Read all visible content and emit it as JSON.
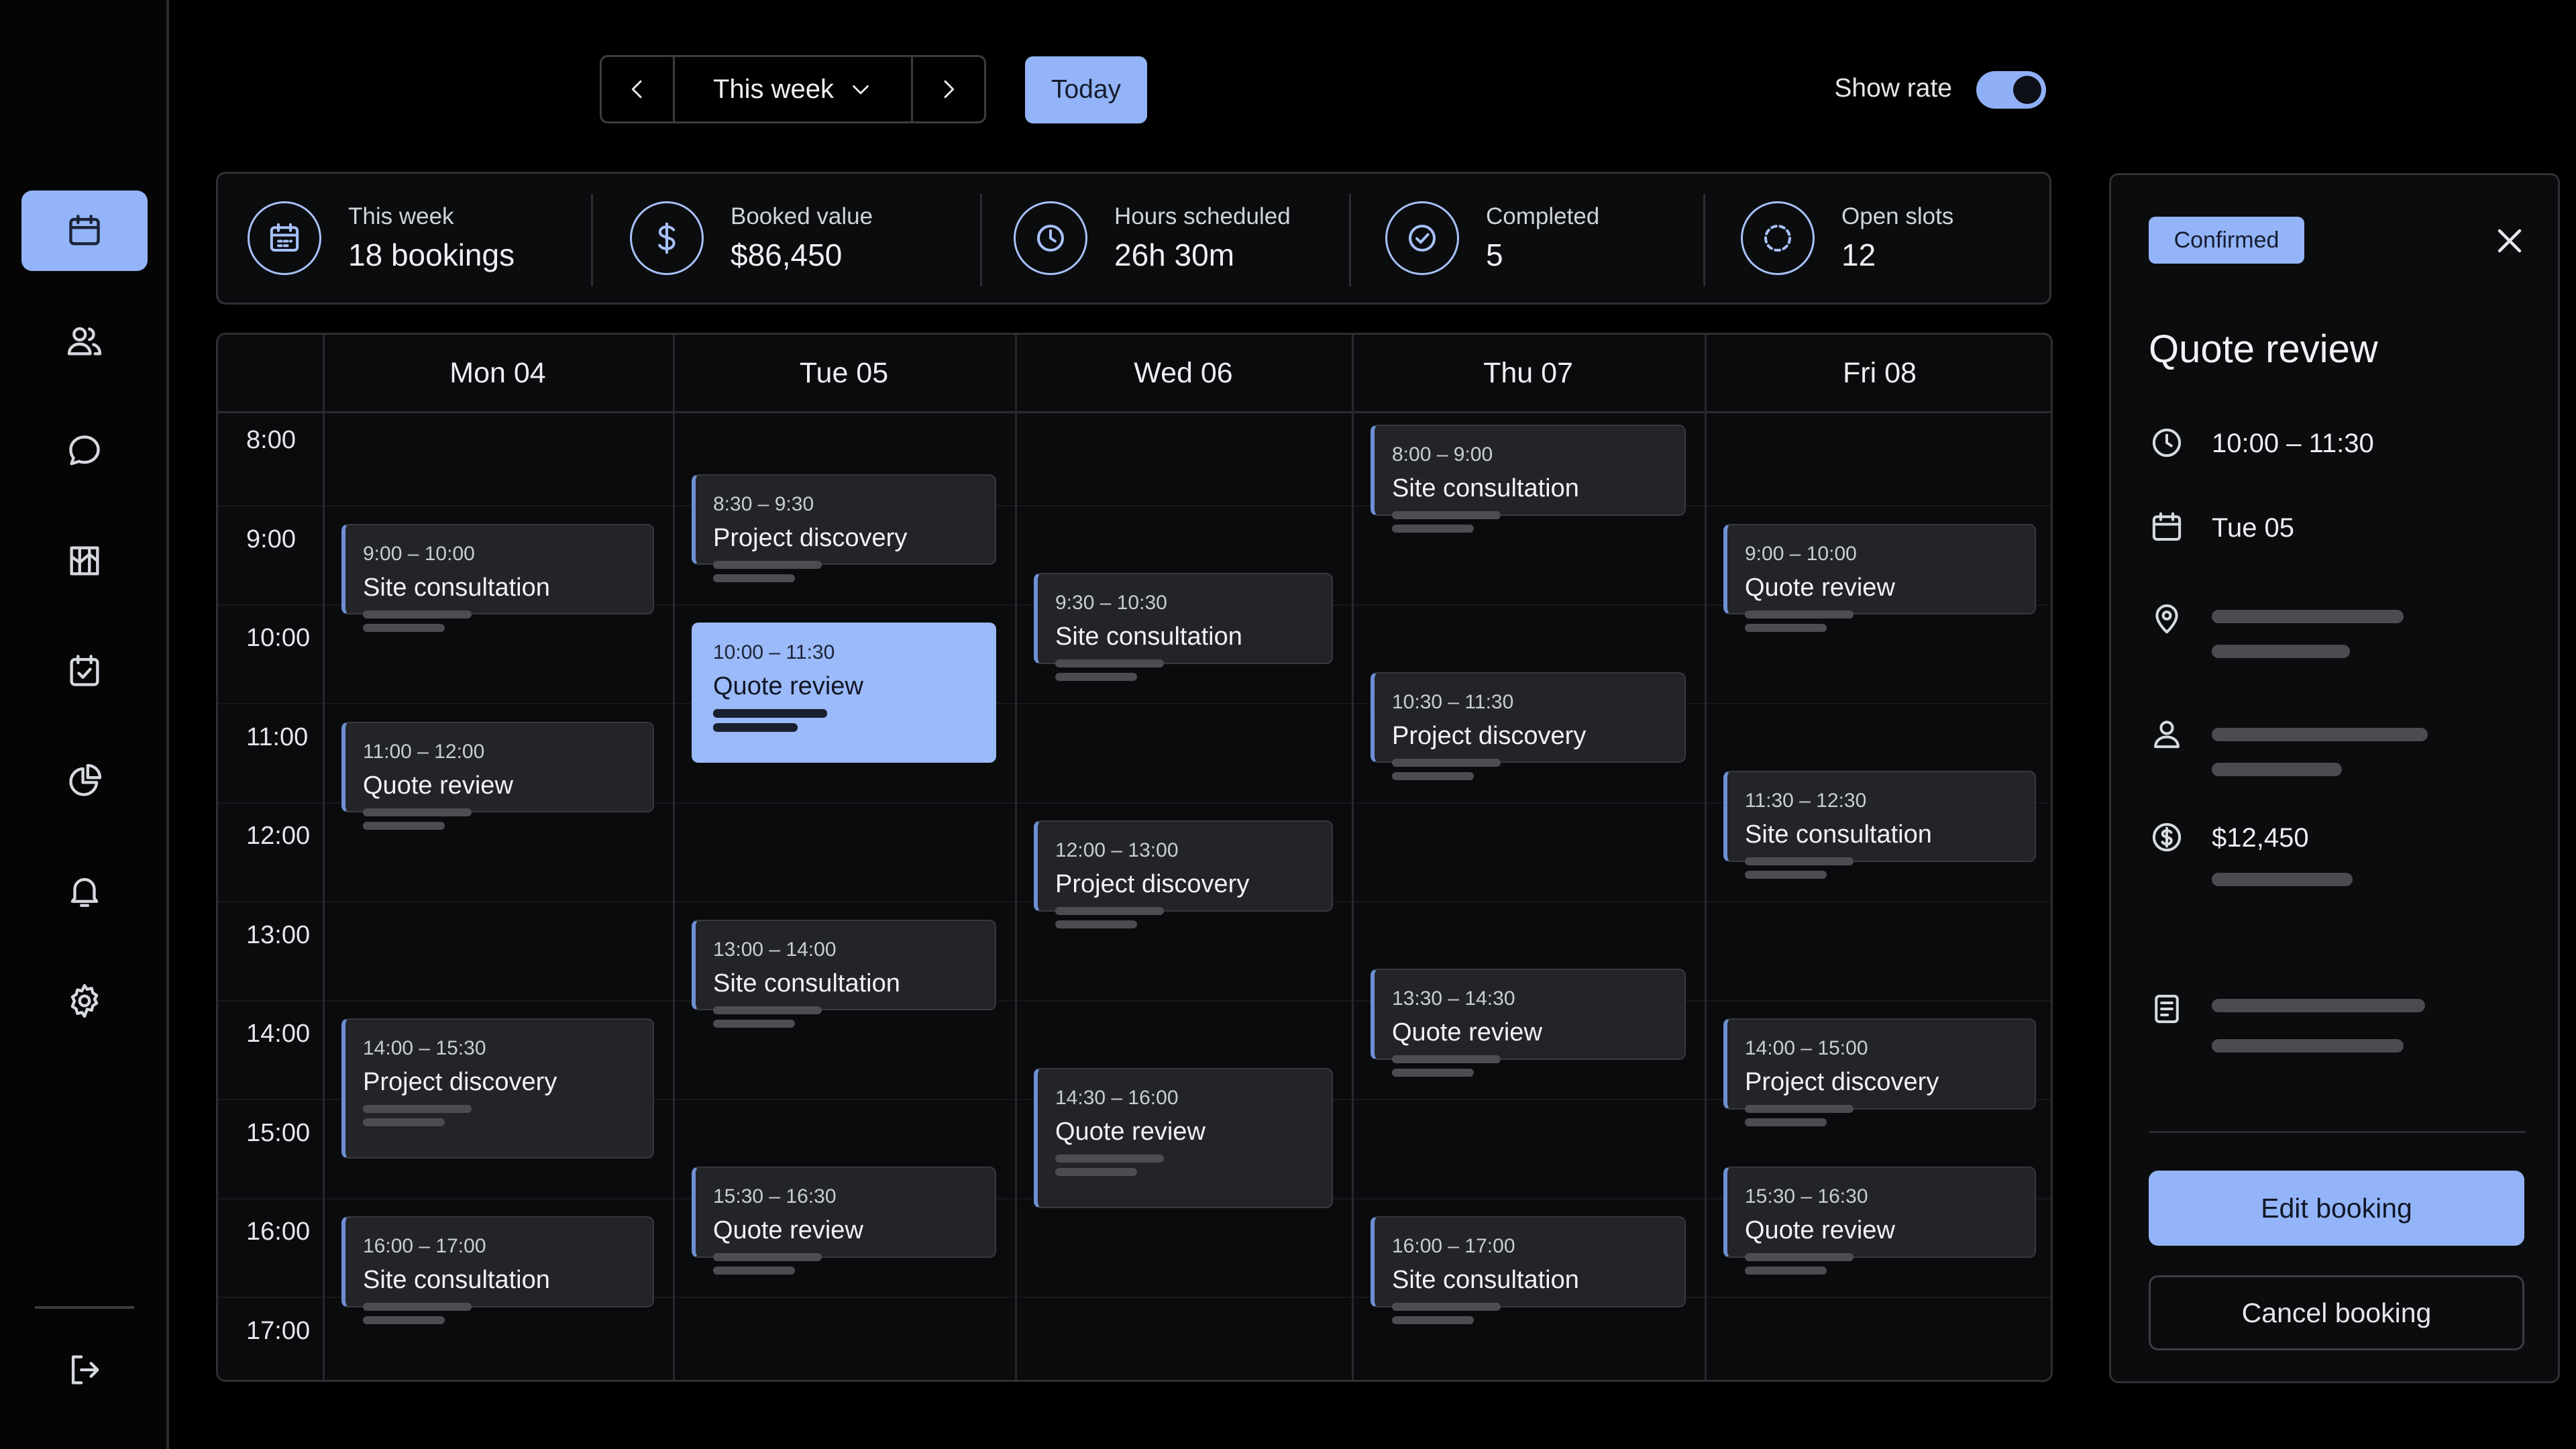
{
  "toolbar": {
    "range_label": "This week",
    "today_label": "Today",
    "show_rate_label": "Show rate",
    "show_rate_on": true
  },
  "sidebar": {
    "items": [
      {
        "icon": "calendar-icon",
        "active": true
      },
      {
        "icon": "users-icon",
        "active": false
      },
      {
        "icon": "chat-icon",
        "active": false
      },
      {
        "icon": "map-icon",
        "active": false
      },
      {
        "icon": "calendar-check-icon",
        "active": false
      },
      {
        "icon": "pie-chart-icon",
        "active": false
      },
      {
        "icon": "bell-icon",
        "active": false
      },
      {
        "icon": "settings-icon",
        "active": false
      }
    ],
    "logout_icon": "logout-icon"
  },
  "stats": [
    {
      "label": "This week",
      "value": "18 bookings",
      "icon": "calendar-icon"
    },
    {
      "label": "Booked value",
      "value": "$86,450",
      "icon": "dollar-icon"
    },
    {
      "label": "Hours scheduled",
      "value": "26h 30m",
      "icon": "clock-icon"
    },
    {
      "label": "Completed",
      "value": "5",
      "icon": "check-circle-icon"
    },
    {
      "label": "Open slots",
      "value": "12",
      "icon": "dashed-circle-icon"
    }
  ],
  "calendar": {
    "days": [
      "Mon 04",
      "Tue 05",
      "Wed 06",
      "Thu 07",
      "Fri 08"
    ],
    "hours": [
      "8:00",
      "9:00",
      "10:00",
      "11:00",
      "12:00",
      "13:00",
      "14:00",
      "15:00",
      "16:00",
      "17:00"
    ],
    "events": [
      {
        "day": 0,
        "start": 9.0,
        "end": 10.0,
        "time": "9:00 – 10:00",
        "title": "Site consultation"
      },
      {
        "day": 0,
        "start": 11.0,
        "end": 12.0,
        "time": "11:00 – 12:00",
        "title": "Quote review"
      },
      {
        "day": 0,
        "start": 14.0,
        "end": 15.5,
        "time": "14:00 – 15:30",
        "title": "Project discovery"
      },
      {
        "day": 0,
        "start": 16.0,
        "end": 17.0,
        "time": "16:00 – 17:00",
        "title": "Site consultation"
      },
      {
        "day": 1,
        "start": 8.5,
        "end": 9.5,
        "time": "8:30 – 9:30",
        "title": "Project discovery"
      },
      {
        "day": 1,
        "start": 10.0,
        "end": 11.5,
        "time": "10:00 – 11:30",
        "title": "Quote review",
        "selected": true
      },
      {
        "day": 1,
        "start": 13.0,
        "end": 14.0,
        "time": "13:00 – 14:00",
        "title": "Site consultation"
      },
      {
        "day": 1,
        "start": 15.5,
        "end": 16.5,
        "time": "15:30 – 16:30",
        "title": "Quote review"
      },
      {
        "day": 2,
        "start": 9.5,
        "end": 10.5,
        "time": "9:30 – 10:30",
        "title": "Site consultation"
      },
      {
        "day": 2,
        "start": 12.0,
        "end": 13.0,
        "time": "12:00 – 13:00",
        "title": "Project discovery"
      },
      {
        "day": 2,
        "start": 14.5,
        "end": 16.0,
        "time": "14:30 – 16:00",
        "title": "Quote review"
      },
      {
        "day": 3,
        "start": 8.0,
        "end": 9.0,
        "time": "8:00 – 9:00",
        "title": "Site consultation"
      },
      {
        "day": 3,
        "start": 10.5,
        "end": 11.5,
        "time": "10:30 – 11:30",
        "title": "Project discovery"
      },
      {
        "day": 3,
        "start": 13.5,
        "end": 14.5,
        "time": "13:30 – 14:30",
        "title": "Quote review"
      },
      {
        "day": 3,
        "start": 16.0,
        "end": 17.0,
        "time": "16:00 – 17:00",
        "title": "Site consultation"
      },
      {
        "day": 4,
        "start": 9.0,
        "end": 10.0,
        "time": "9:00 – 10:00",
        "title": "Quote review"
      },
      {
        "day": 4,
        "start": 11.5,
        "end": 12.5,
        "time": "11:30 – 12:30",
        "title": "Site consultation"
      },
      {
        "day": 4,
        "start": 14.0,
        "end": 15.0,
        "time": "14:00 – 15:00",
        "title": "Project discovery"
      },
      {
        "day": 4,
        "start": 15.5,
        "end": 16.5,
        "time": "15:30 – 16:30",
        "title": "Quote review"
      }
    ]
  },
  "detail": {
    "status": "Confirmed",
    "title": "Quote review",
    "time": "10:00 – 11:30",
    "date": "Tue 05",
    "amount": "$12,450",
    "edit_label": "Edit booking",
    "cancel_label": "Cancel booking"
  },
  "colors": {
    "accent": "#93b4f8",
    "background": "#000000",
    "card": "#232428"
  }
}
